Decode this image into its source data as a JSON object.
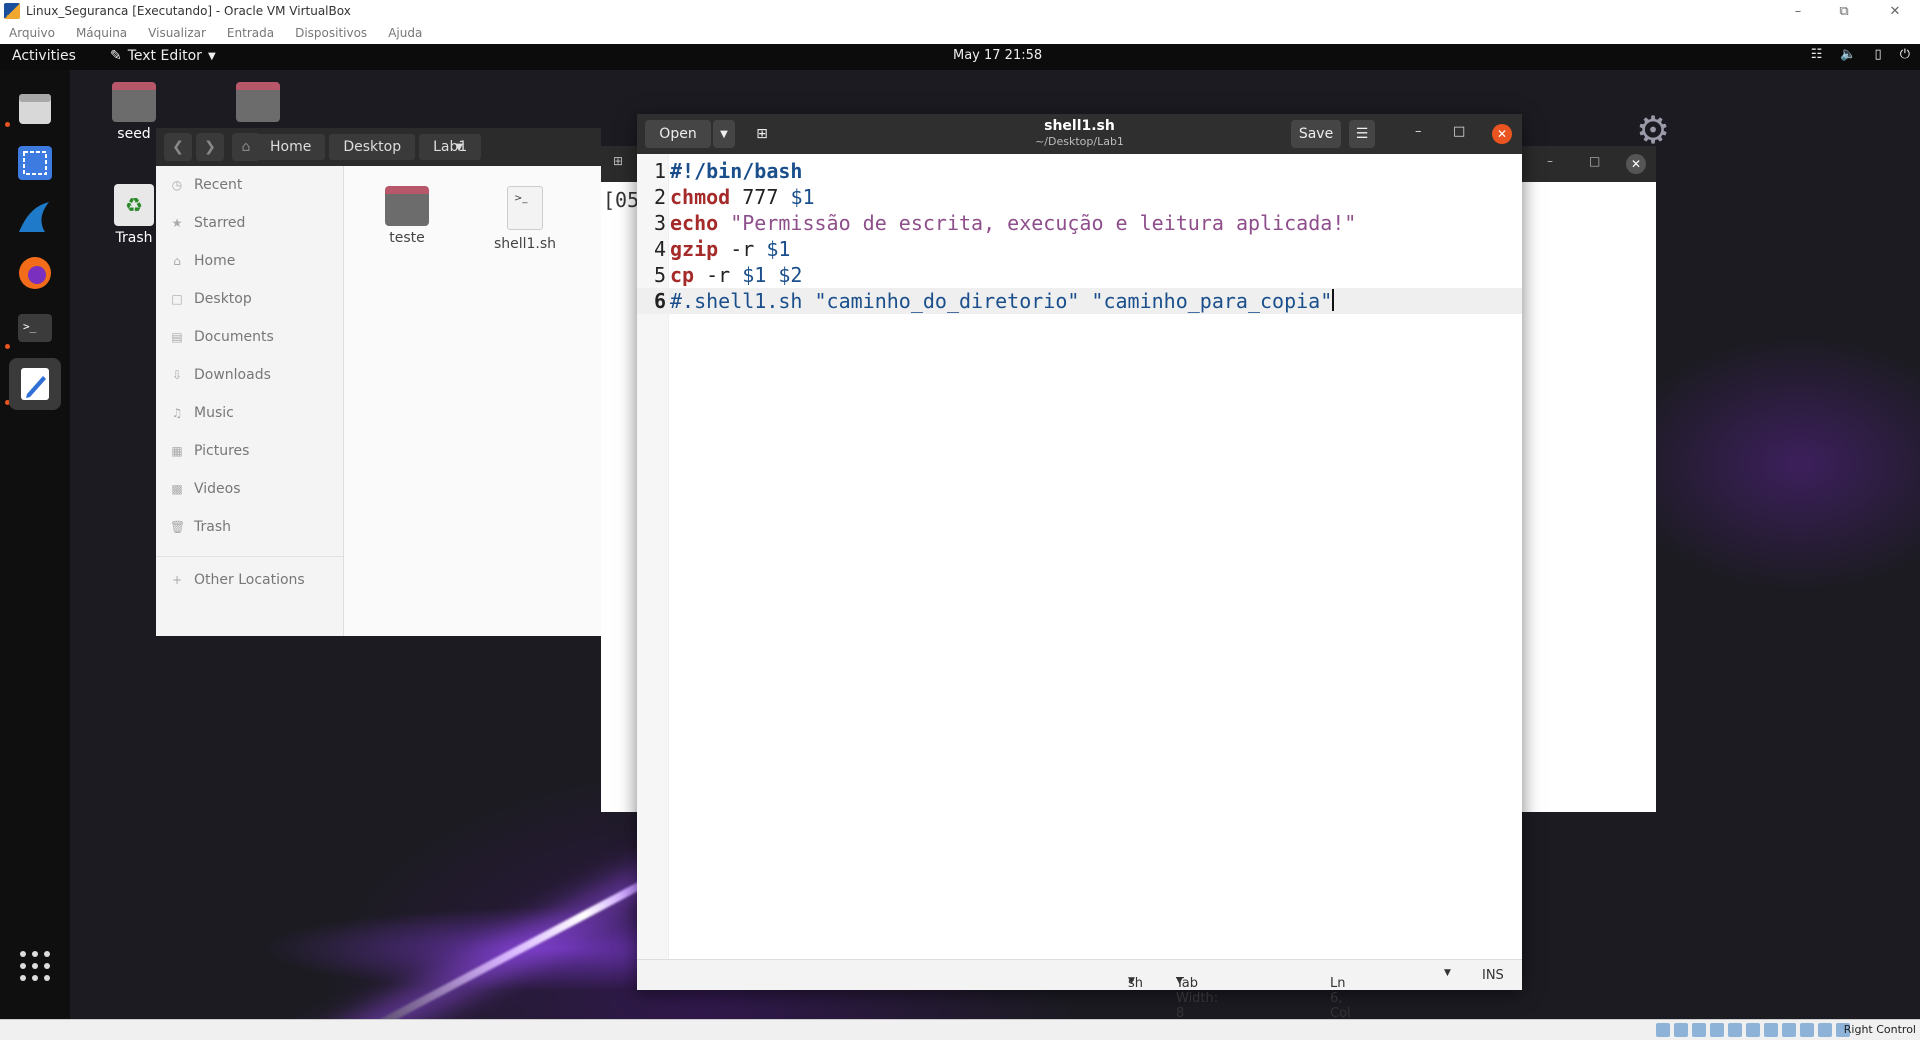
{
  "host": {
    "title": "Linux_Seguranca [Executando] - Oracle VM VirtualBox",
    "menu": [
      "Arquivo",
      "Máquina",
      "Visualizar",
      "Entrada",
      "Dispositivos",
      "Ajuda"
    ],
    "status_key": "Right Control"
  },
  "topbar": {
    "activities": "Activities",
    "app_menu": "Text Editor",
    "clock": "May 17  21:58"
  },
  "desktop": {
    "icons": [
      "seed",
      "Trash"
    ]
  },
  "files_window": {
    "breadcrumbs": [
      "Home",
      "Desktop",
      "Lab1"
    ],
    "sidebar": [
      "Recent",
      "Starred",
      "Home",
      "Desktop",
      "Documents",
      "Downloads",
      "Music",
      "Pictures",
      "Videos",
      "Trash"
    ],
    "other_locations": "Other Locations",
    "items": [
      {
        "name": "teste",
        "kind": "folder"
      },
      {
        "name": "shell1.sh",
        "kind": "script"
      }
    ]
  },
  "terminal": {
    "visible_text": "[05"
  },
  "gedit": {
    "open_label": "Open",
    "save_label": "Save",
    "title": "shell1.sh",
    "subtitle": "~/Desktop/Lab1",
    "lines": [
      {
        "n": "1",
        "tokens": [
          {
            "t": "#!/bin/bash",
            "c": "cmtb"
          }
        ]
      },
      {
        "n": "2",
        "tokens": [
          {
            "t": "chmod",
            "c": "kw"
          },
          {
            "t": " 777 ",
            "c": "plain"
          },
          {
            "t": "$1",
            "c": "var"
          }
        ]
      },
      {
        "n": "3",
        "tokens": [
          {
            "t": "echo",
            "c": "kw"
          },
          {
            "t": " ",
            "c": "plain"
          },
          {
            "t": "\"Permissão de escrita, execução e leitura aplicada!\"",
            "c": "str"
          }
        ]
      },
      {
        "n": "4",
        "tokens": [
          {
            "t": "gzip",
            "c": "kw"
          },
          {
            "t": " -r ",
            "c": "plain"
          },
          {
            "t": "$1",
            "c": "var"
          }
        ]
      },
      {
        "n": "5",
        "tokens": [
          {
            "t": "cp",
            "c": "kw"
          },
          {
            "t": " -r ",
            "c": "plain"
          },
          {
            "t": "$1 $2",
            "c": "var"
          }
        ]
      },
      {
        "n": "6",
        "tokens": [
          {
            "t": "#.shell1.sh \"caminho_do_diretorio\" \"caminho_para_copia\"",
            "c": "cmt"
          }
        ]
      }
    ],
    "current_line": 6,
    "status": {
      "language": "sh",
      "tab_width": "Tab Width: 8",
      "position": "Ln 6, Col 56",
      "mode": "INS"
    }
  }
}
